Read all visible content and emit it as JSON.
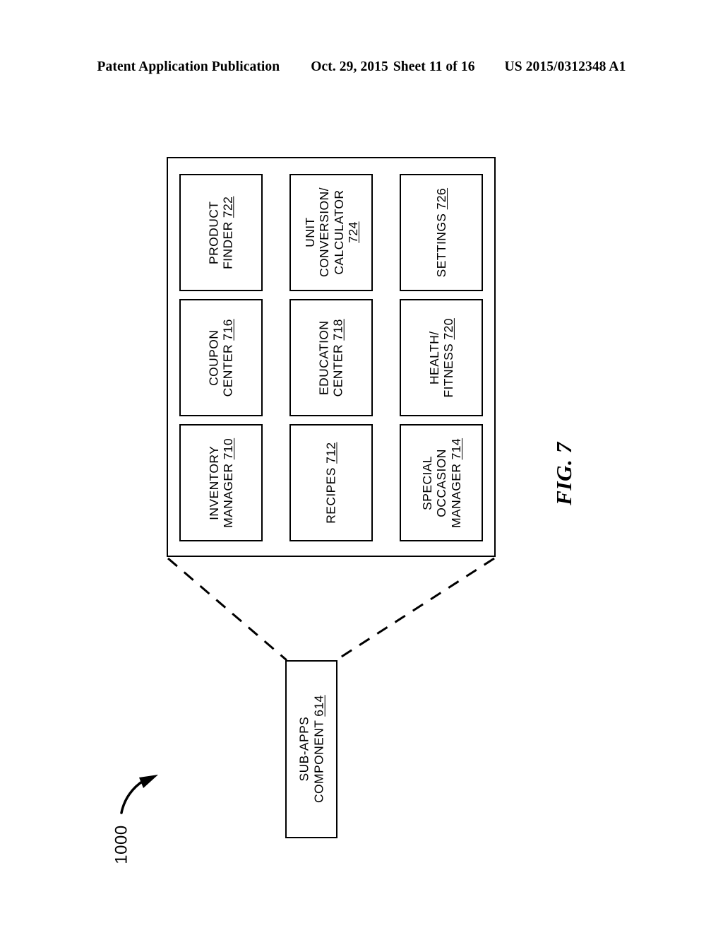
{
  "header": {
    "publication": "Patent Application Publication",
    "date": "Oct. 29, 2015",
    "sheet": "Sheet 11 of 16",
    "number": "US 2015/0312348 A1"
  },
  "figure": {
    "caption": "FIG. 7",
    "reference_numeral": "1000",
    "component_box": {
      "line1": "SUB-APPS",
      "line2": "COMPONENT ",
      "ref": "614"
    },
    "sub_apps": [
      {
        "name": "product-finder",
        "line1": "PRODUCT",
        "line2": "FINDER ",
        "ref": "722",
        "lines": 2
      },
      {
        "name": "unit-conversion-calculator",
        "line1": "UNIT",
        "line2": "CONVERSION/",
        "line3": "CALCULATOR",
        "ref": "724",
        "lines": 4
      },
      {
        "name": "settings",
        "line1": "SETTINGS ",
        "ref": "726",
        "lines": 1
      },
      {
        "name": "coupon-center",
        "line1": "COUPON",
        "line2": "CENTER ",
        "ref": "716",
        "lines": 2
      },
      {
        "name": "education-center",
        "line1": "EDUCATION",
        "line2": "CENTER ",
        "ref": "718",
        "lines": 2
      },
      {
        "name": "health-fitness",
        "line1": "HEALTH/",
        "line2": "FITNESS ",
        "ref": "720",
        "lines": 2
      },
      {
        "name": "inventory-manager",
        "line1": "INVENTORY",
        "line2": "MANAGER ",
        "ref": "710",
        "lines": 2
      },
      {
        "name": "recipes",
        "line1": "RECIPES ",
        "ref": "712",
        "lines": 1
      },
      {
        "name": "special-occasion-manager",
        "line1": "SPECIAL",
        "line2": "OCCASION",
        "line3": "MANAGER ",
        "ref": "714",
        "lines": 3
      }
    ]
  }
}
